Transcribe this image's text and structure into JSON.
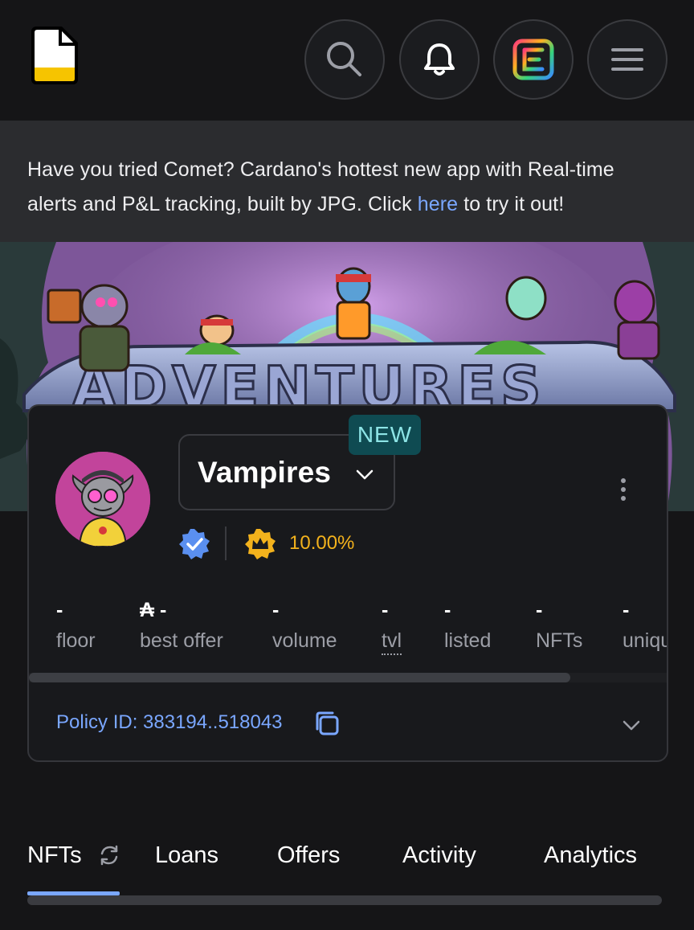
{
  "header": {
    "logo_icon": "jpg-store-logo",
    "search_icon": "search-icon",
    "notifications_icon": "bell-icon",
    "comet_icon": "comet-app-icon",
    "menu_icon": "hamburger-menu-icon"
  },
  "notice": {
    "text_before": "Have you tried Comet? Cardano's hottest new app with Real-time alerts and P&L tracking, built by JPG. Click ",
    "link_text": "here",
    "text_after": " to try it out!"
  },
  "collection": {
    "name": "Vampires",
    "badge": "NEW",
    "royalty": "10.00%",
    "policy_label": "Policy ID: 383194..518043"
  },
  "stats": [
    {
      "value": "-",
      "label": "floor"
    },
    {
      "value": "₳ -",
      "label": "best offer"
    },
    {
      "value": "-",
      "label": "volume"
    },
    {
      "value": "-",
      "label": "tvl"
    },
    {
      "value": "-",
      "label": "listed"
    },
    {
      "value": "-",
      "label": "NFTs"
    },
    {
      "value": "-",
      "label": "uniqu"
    }
  ],
  "tabs": [
    {
      "label": "NFTs",
      "active": true
    },
    {
      "label": "Loans",
      "active": false
    },
    {
      "label": "Offers",
      "active": false
    },
    {
      "label": "Activity",
      "active": false
    },
    {
      "label": "Analytics",
      "active": false
    }
  ],
  "colors": {
    "background": "#151517",
    "card": "#18191c",
    "link": "#7aa7ff",
    "royalty": "#f3b21c",
    "badge_bg": "#0f4b52",
    "badge_text": "#8de4e6"
  }
}
